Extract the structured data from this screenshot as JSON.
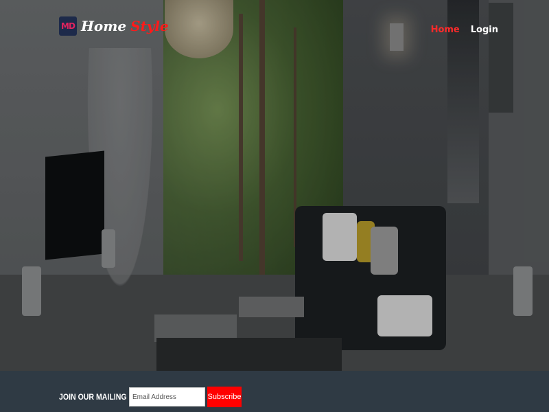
{
  "brand": {
    "logo_icon": "md-logo-icon",
    "logo_text": "MD",
    "name_part1": "Home",
    "name_part2": "Style",
    "colors": {
      "part1": "#ffffff",
      "part2": "#ff1a1a",
      "logo_bg": "#1d2a4a",
      "logo_mark": "#e0245e"
    }
  },
  "nav": {
    "items": [
      {
        "label": "Home",
        "active": true
      },
      {
        "label": "Login",
        "active": false
      }
    ],
    "active_color": "#ff2a2a"
  },
  "hero": {
    "image_description_icon": "living-room-photo"
  },
  "footer": {
    "mailing_label": "JOIN OUR MAILING LIST:",
    "email_placeholder": "Email Address",
    "email_value": "",
    "subscribe_label": "Subscribe",
    "bar_color": "#2f3a44",
    "button_color": "#ff0000"
  }
}
